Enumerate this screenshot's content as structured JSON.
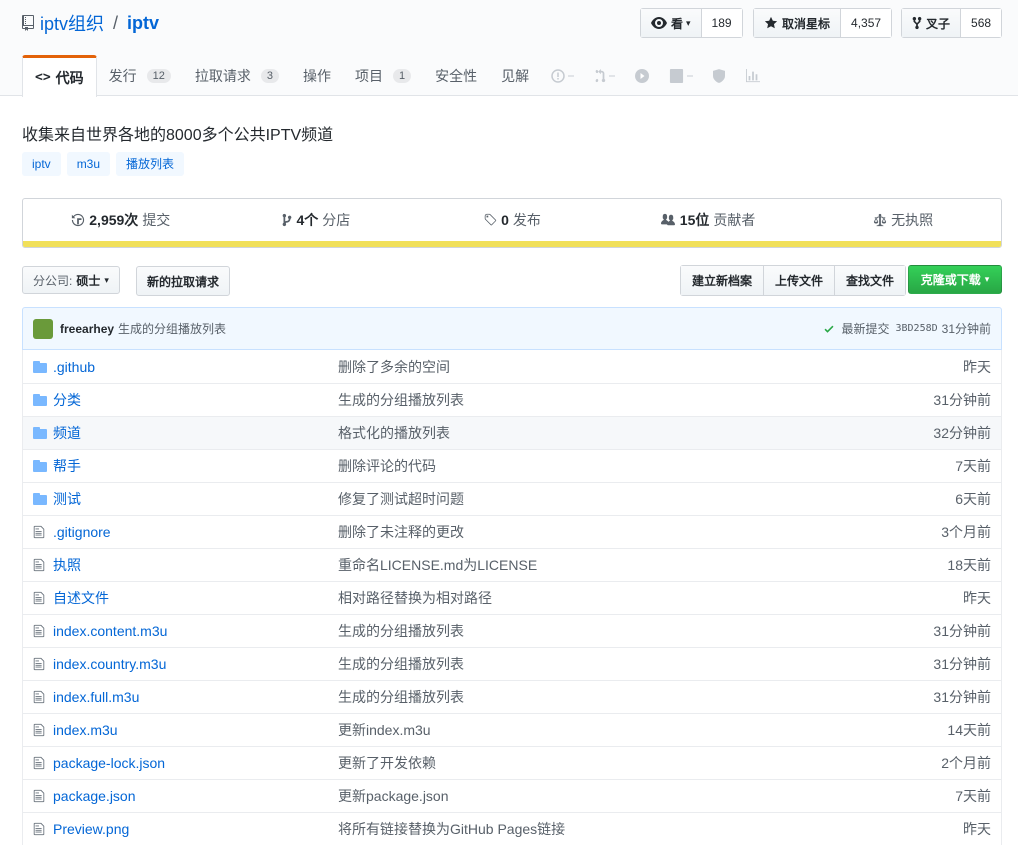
{
  "repo": {
    "owner": "iptv组织",
    "separator": "/",
    "name": "iptv"
  },
  "actions": {
    "watch": {
      "label": "看",
      "count": "189"
    },
    "star": {
      "label": "取消星标",
      "count": "4,357"
    },
    "fork": {
      "label": "叉子",
      "count": "568"
    }
  },
  "tabs": [
    {
      "label": "代码",
      "count": ""
    },
    {
      "label": "发行",
      "count": "12"
    },
    {
      "label": "拉取请求",
      "count": "3"
    },
    {
      "label": "操作",
      "count": ""
    },
    {
      "label": "项目",
      "count": "1"
    },
    {
      "label": "安全性",
      "count": ""
    },
    {
      "label": "见解",
      "count": ""
    }
  ],
  "description": "收集来自世界各地的8000多个公共IPTV频道",
  "topics": [
    "iptv",
    "m3u",
    "播放列表"
  ],
  "summary": {
    "commits": {
      "value": "2,959次",
      "label": "提交"
    },
    "branches": {
      "value": "4个",
      "label": "分店"
    },
    "releases": {
      "value": "0",
      "label": "发布"
    },
    "contributors": {
      "value": "15位",
      "label": "贡献者"
    },
    "license": {
      "label": "无执照"
    },
    "lang_color": "#f1e05a"
  },
  "toolbar": {
    "branch_prefix": "分公司:",
    "branch_name": "硕士",
    "new_pr": "新的拉取请求",
    "create_file": "建立新档案",
    "upload": "上传文件",
    "find": "查找文件",
    "clone": "克隆或下载"
  },
  "latest_commit": {
    "author": "freearhey",
    "message": "生成的分组播放列表",
    "label": "最新提交",
    "sha": "3BD258D",
    "age": "31分钟前"
  },
  "files": [
    {
      "type": "dir",
      "name": ".github",
      "message": "删除了多余的空间",
      "age": "昨天"
    },
    {
      "type": "dir",
      "name": "分类",
      "message": "生成的分组播放列表",
      "age": "31分钟前"
    },
    {
      "type": "dir",
      "name": "频道",
      "message": "格式化的播放列表",
      "age": "32分钟前"
    },
    {
      "type": "dir",
      "name": "帮手",
      "message": "删除评论的代码",
      "age": "7天前"
    },
    {
      "type": "dir",
      "name": "测试",
      "message": "修复了测试超时问题",
      "age": "6天前"
    },
    {
      "type": "file",
      "name": ".gitignore",
      "message": "删除了未注释的更改",
      "age": "3个月前"
    },
    {
      "type": "file",
      "name": "执照",
      "message": "重命名LICENSE.md为LICENSE",
      "age": "18天前"
    },
    {
      "type": "file",
      "name": "自述文件",
      "message": "相对路径替换为相对路径",
      "age": "昨天"
    },
    {
      "type": "file",
      "name": "index.content.m3u",
      "message": "生成的分组播放列表",
      "age": "31分钟前"
    },
    {
      "type": "file",
      "name": "index.country.m3u",
      "message": "生成的分组播放列表",
      "age": "31分钟前"
    },
    {
      "type": "file",
      "name": "index.full.m3u",
      "message": "生成的分组播放列表",
      "age": "31分钟前"
    },
    {
      "type": "file",
      "name": "index.m3u",
      "message": "更新index.m3u",
      "age": "14天前"
    },
    {
      "type": "file",
      "name": "package-lock.json",
      "message": "更新了开发依赖",
      "age": "2个月前"
    },
    {
      "type": "file",
      "name": "package.json",
      "message": "更新package.json",
      "age": "7天前"
    },
    {
      "type": "file",
      "name": "Preview.png",
      "message": "将所有链接替换为GitHub Pages链接",
      "age": "昨天"
    }
  ]
}
